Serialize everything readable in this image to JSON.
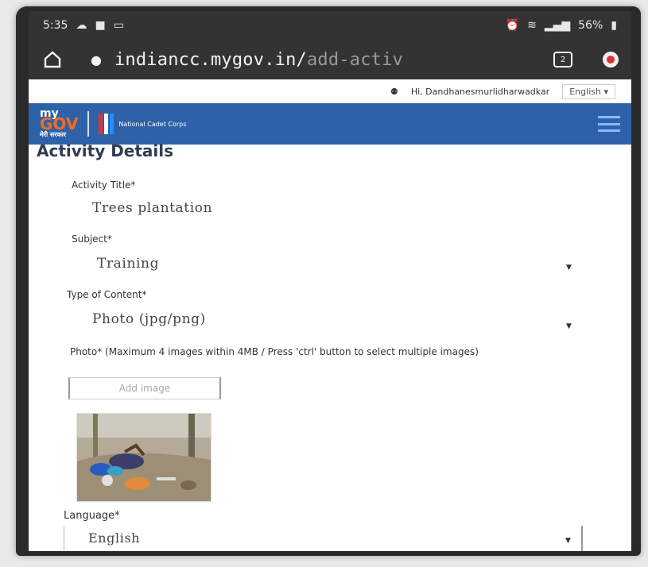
{
  "status_bar": {
    "time": "5:35",
    "battery": "56%"
  },
  "browser": {
    "url_domain": "indiancc.mygov.in/",
    "url_path": "add-activ"
  },
  "user_bar": {
    "greeting": "Hi, Dandhanesmurlidharwadkar",
    "language": "English"
  },
  "nav": {
    "logo_my": "my",
    "logo_gov": "GOV",
    "logo_sub": "मेरी सरकार",
    "nss_text": "National Cadet Corps"
  },
  "form": {
    "title": "Activity Details",
    "activity_title_label": "Activity Title*",
    "activity_title_value": "Trees plantation",
    "subject_label": "Subject*",
    "subject_value": "Training",
    "content_type_label": "Type of Content*",
    "content_type_value": "Photo (jpg/png)",
    "photo_label": "Photo* (Maximum 4 images within 4MB / Press 'ctrl' button to select multiple images)",
    "add_image_label": "Add image",
    "language_label": "Language*",
    "language_value": "English"
  },
  "colors": {
    "nav_blue": "#2d62a8",
    "browser_dark": "#333333",
    "gov_orange": "#f26c22"
  }
}
